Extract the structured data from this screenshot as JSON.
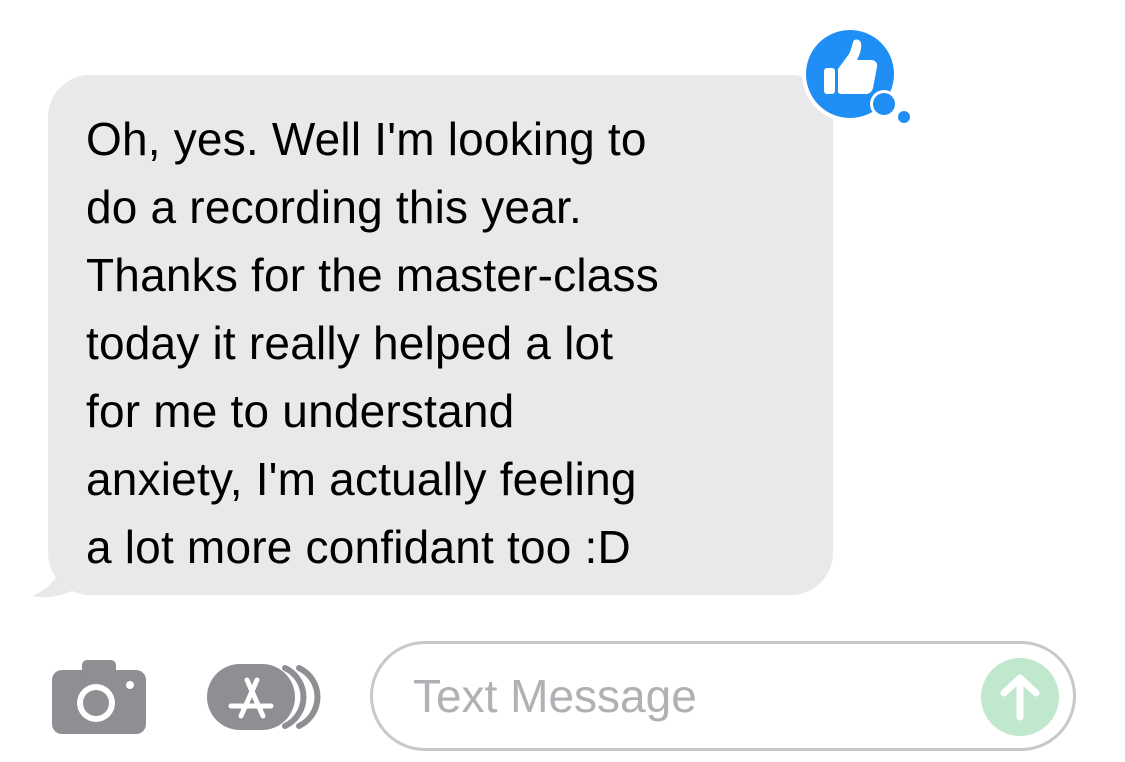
{
  "conversation": {
    "message": {
      "lines": [
        "Oh, yes. Well I'm looking to",
        "do a recording this year.",
        "Thanks for the master-class",
        "today it really helped a lot",
        "for me to understand",
        "anxiety, I'm actually feeling",
        "a lot more confidant too :D"
      ],
      "reaction": "thumbs-up-icon"
    }
  },
  "composer": {
    "placeholder": "Text Message",
    "camera_icon": "camera-icon",
    "appstore_icon": "app-store-icon",
    "send_icon": "send-arrow-icon"
  },
  "colors": {
    "incoming_bubble": "#e9e9eb",
    "reaction_blue": "#1f8ff5",
    "icon_gray": "#8e8e93",
    "send_disabled": "#bfe8cd",
    "field_border": "#c8c8cc",
    "placeholder": "#b0b0b5"
  }
}
